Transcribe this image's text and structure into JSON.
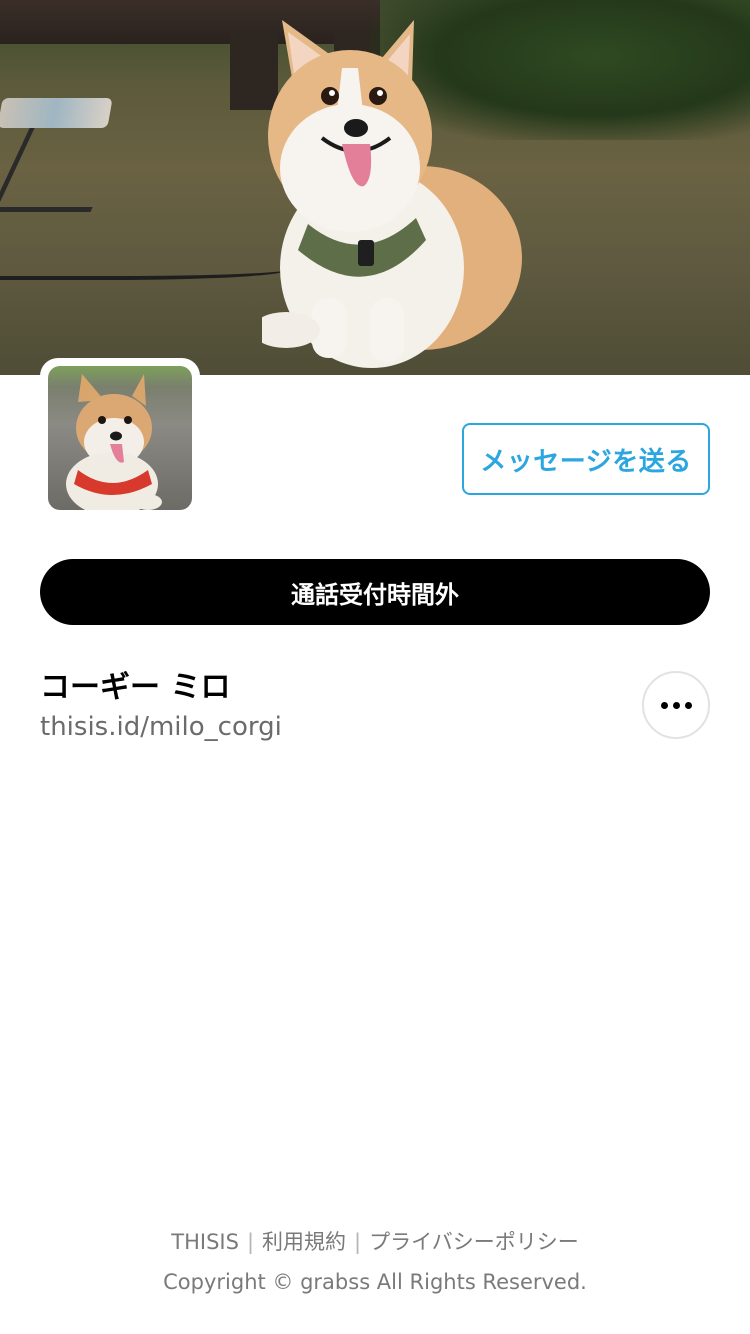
{
  "cover_photo": {
    "alt": "cover-photo-corgi-sitting-on-grass"
  },
  "avatar": {
    "alt": "profile-photo-corgi"
  },
  "actions": {
    "message_label": "メッセージを送る",
    "call_status_label": "通話受付時間外"
  },
  "profile": {
    "name": "コーギー ミロ",
    "handle": "thisis.id/milo_corgi"
  },
  "more_icon": "ellipsis-horizontal-icon",
  "footer": {
    "links": [
      "THISIS",
      "利用規約",
      "プライバシーポリシー"
    ],
    "separator": "|",
    "copyright": "Copyright © grabss All Rights Reserved."
  },
  "colors": {
    "accent": "#2ba6e0",
    "call_button_bg": "#000000",
    "muted_text": "#6b6b6b"
  }
}
